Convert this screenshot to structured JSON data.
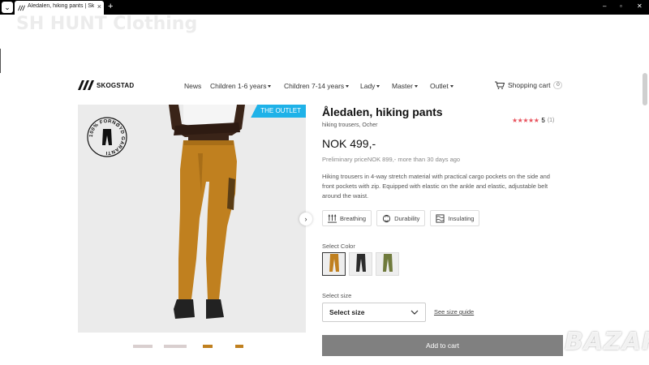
{
  "browser": {
    "tab_title": "Åledalen, hiking pants | Skogstad",
    "new_tab_label": "+",
    "window_controls": [
      "–",
      "▫",
      "✕"
    ]
  },
  "watermarks": {
    "top": "SH HUNT Clothing",
    "bottom": "BAZAR"
  },
  "header": {
    "logo_text": "SKOGSTAD",
    "nav": [
      {
        "label": "News"
      },
      {
        "label": "Children 1-6 years"
      },
      {
        "label": "Children 7-14 years"
      },
      {
        "label": "Lady"
      },
      {
        "label": "Master"
      },
      {
        "label": "Outlet"
      }
    ],
    "cart_label": "Shopping cart",
    "cart_count": "0"
  },
  "gallery": {
    "badge": "THE OUTLET",
    "guarantee_text": "100% FORNØYD GARANTI",
    "next_icon": "chevron-right-icon"
  },
  "product": {
    "title": "Åledalen, hiking pants",
    "subtitle": "hiking trousers, Ocher",
    "rating": "5",
    "rating_count": "(1)",
    "price": "NOK  499,-",
    "preliminary_price": "Preliminary priceNOK  899,- more than 30 days ago",
    "description": "Hiking trousers in 4-way stretch material with practical cargo pockets on the side and front pockets with zip. Equipped with elastic on the ankle and elastic, adjustable belt around the waist.",
    "features": [
      {
        "label": "Breathing",
        "icon": "breathing-icon"
      },
      {
        "label": "Durability",
        "icon": "recycle-icon"
      },
      {
        "label": "Insulating",
        "icon": "insulating-icon"
      }
    ],
    "color_label": "Select Color",
    "colors": [
      {
        "name": "Ocher",
        "hex": "#c0801f",
        "selected": true
      },
      {
        "name": "Black",
        "hex": "#2b2b2b",
        "selected": false
      },
      {
        "name": "Olive",
        "hex": "#6f7a3c",
        "selected": false
      }
    ],
    "size_label": "Select size",
    "size_value": "Select size",
    "size_guide": "See size guide",
    "add_to_cart": "Add to cart"
  },
  "colors": {
    "accent_badge": "#1fb2e8",
    "stars": "#e8505b",
    "pants": "#c0801f",
    "button": "#808080"
  }
}
